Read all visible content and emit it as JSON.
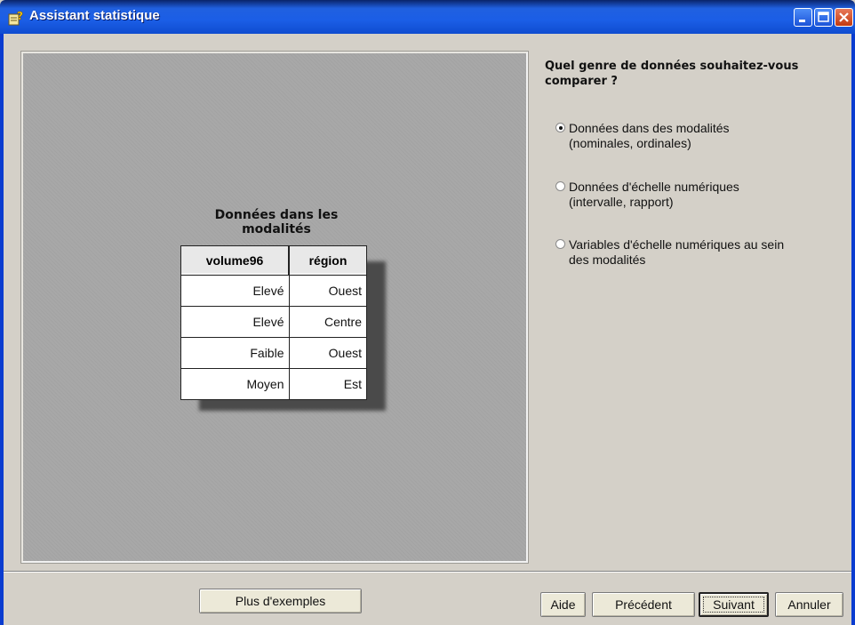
{
  "window": {
    "title": "Assistant statistique"
  },
  "preview": {
    "title_line1": "Données dans les",
    "title_line2": "modalités",
    "columns": [
      "volume96",
      "région"
    ],
    "rows": [
      [
        "Elevé",
        "Ouest"
      ],
      [
        "Elevé",
        "Centre"
      ],
      [
        "Faible",
        "Ouest"
      ],
      [
        "Moyen",
        "Est"
      ]
    ]
  },
  "question": {
    "line1": "Quel genre de données souhaitez-vous",
    "line2": "comparer ?"
  },
  "options": [
    {
      "line1": "Données dans des modalités",
      "line2": "(nominales, ordinales)",
      "selected": true
    },
    {
      "line1": "Données d'échelle numériques",
      "line2": "(intervalle, rapport)",
      "selected": false
    },
    {
      "line1": "Variables d'échelle numériques au sein",
      "line2": "des modalités",
      "selected": false
    }
  ],
  "buttons": {
    "more_examples": "Plus d'exemples",
    "help": "Aide",
    "previous": "Précédent",
    "next": "Suivant",
    "cancel": "Annuler"
  }
}
